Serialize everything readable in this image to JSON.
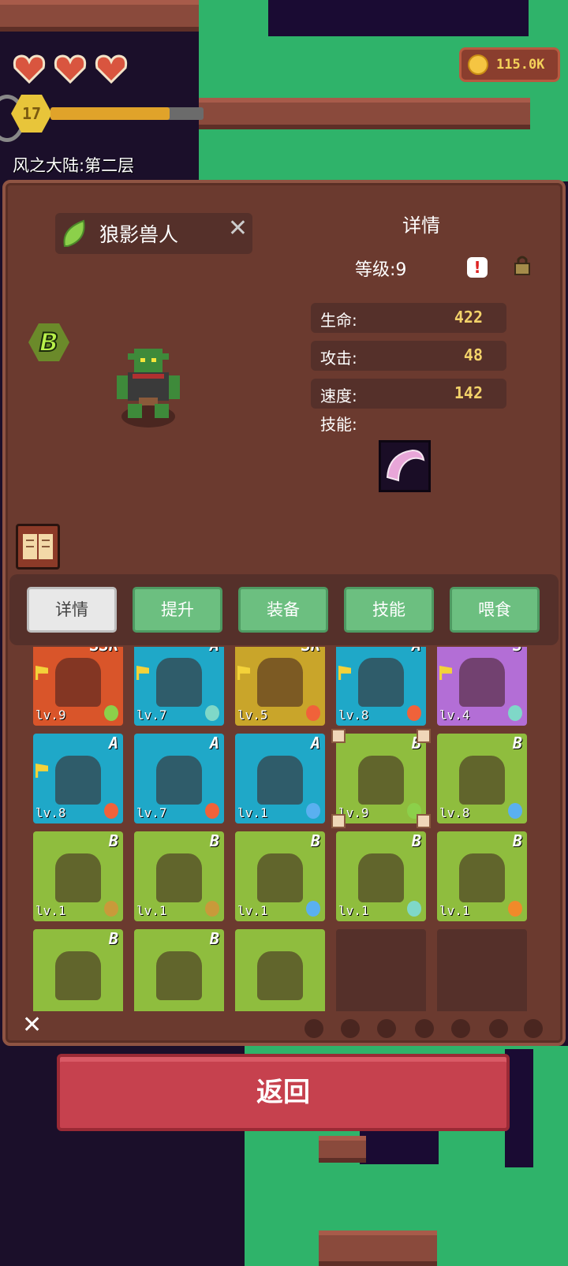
{
  "hud": {
    "floor_title": "风之大陆:第二层",
    "player_level": "17",
    "xp_fraction": 0.78,
    "coins": "115.0K",
    "hearts": 3
  },
  "detail": {
    "monster_name": "狼影兽人",
    "title": "详情",
    "level_text": "等级:9",
    "rank": "B",
    "stats": [
      {
        "label": "生命:",
        "value": "422"
      },
      {
        "label": "攻击:",
        "value": "48"
      },
      {
        "label": "速度:",
        "value": "142"
      }
    ],
    "skill_label": "技能:"
  },
  "tabs": [
    "详情",
    "提升",
    "装备",
    "技能",
    "喂食"
  ],
  "monsters": [
    {
      "rank": "SSR",
      "level": "lv.9",
      "bg": "#d9552a",
      "element": "leaf",
      "flag": true
    },
    {
      "rank": "A",
      "level": "lv.7",
      "bg": "#1fa8c8",
      "element": "wind",
      "flag": true
    },
    {
      "rank": "SR",
      "level": "lv.5",
      "bg": "#c9a52a",
      "element": "fire",
      "flag": true
    },
    {
      "rank": "A",
      "level": "lv.8",
      "bg": "#1fa8c8",
      "element": "fire",
      "flag": true
    },
    {
      "rank": "S",
      "level": "lv.4",
      "bg": "#b36ed6",
      "element": "wind",
      "flag": true
    },
    {
      "rank": "A",
      "level": "lv.8",
      "bg": "#1fa8c8",
      "element": "fire",
      "flag": true
    },
    {
      "rank": "A",
      "level": "lv.7",
      "bg": "#1fa8c8",
      "element": "fire",
      "flag": false
    },
    {
      "rank": "A",
      "level": "lv.1",
      "bg": "#1fa8c8",
      "element": "water",
      "flag": false
    },
    {
      "rank": "B",
      "level": "lv.9",
      "bg": "#8fbd3e",
      "element": "leaf",
      "flag": false,
      "selected": true
    },
    {
      "rank": "B",
      "level": "lv.8",
      "bg": "#8fbd3e",
      "element": "water",
      "flag": false
    },
    {
      "rank": "B",
      "level": "lv.1",
      "bg": "#8fbd3e",
      "element": "earth",
      "flag": false
    },
    {
      "rank": "B",
      "level": "lv.1",
      "bg": "#8fbd3e",
      "element": "earth",
      "flag": false
    },
    {
      "rank": "B",
      "level": "lv.1",
      "bg": "#8fbd3e",
      "element": "water",
      "flag": false
    },
    {
      "rank": "B",
      "level": "lv.1",
      "bg": "#8fbd3e",
      "element": "wind",
      "flag": false
    },
    {
      "rank": "B",
      "level": "lv.1",
      "bg": "#8fbd3e",
      "element": "sun",
      "flag": false
    },
    {
      "rank": "B",
      "level": "",
      "bg": "#8fbd3e",
      "element": "",
      "flag": false
    },
    {
      "rank": "B",
      "level": "",
      "bg": "#8fbd3e",
      "element": "",
      "flag": false
    },
    {
      "rank": "",
      "level": "",
      "bg": "#8fbd3e",
      "element": "",
      "flag": false
    }
  ],
  "back_label": "返回",
  "colors": {
    "panel": "#6b3a2f",
    "tab_inactive": "#6cbf80",
    "tab_active": "#e8e8e8",
    "back_button": "#c6414e",
    "stat_value": "#f3d36a"
  }
}
